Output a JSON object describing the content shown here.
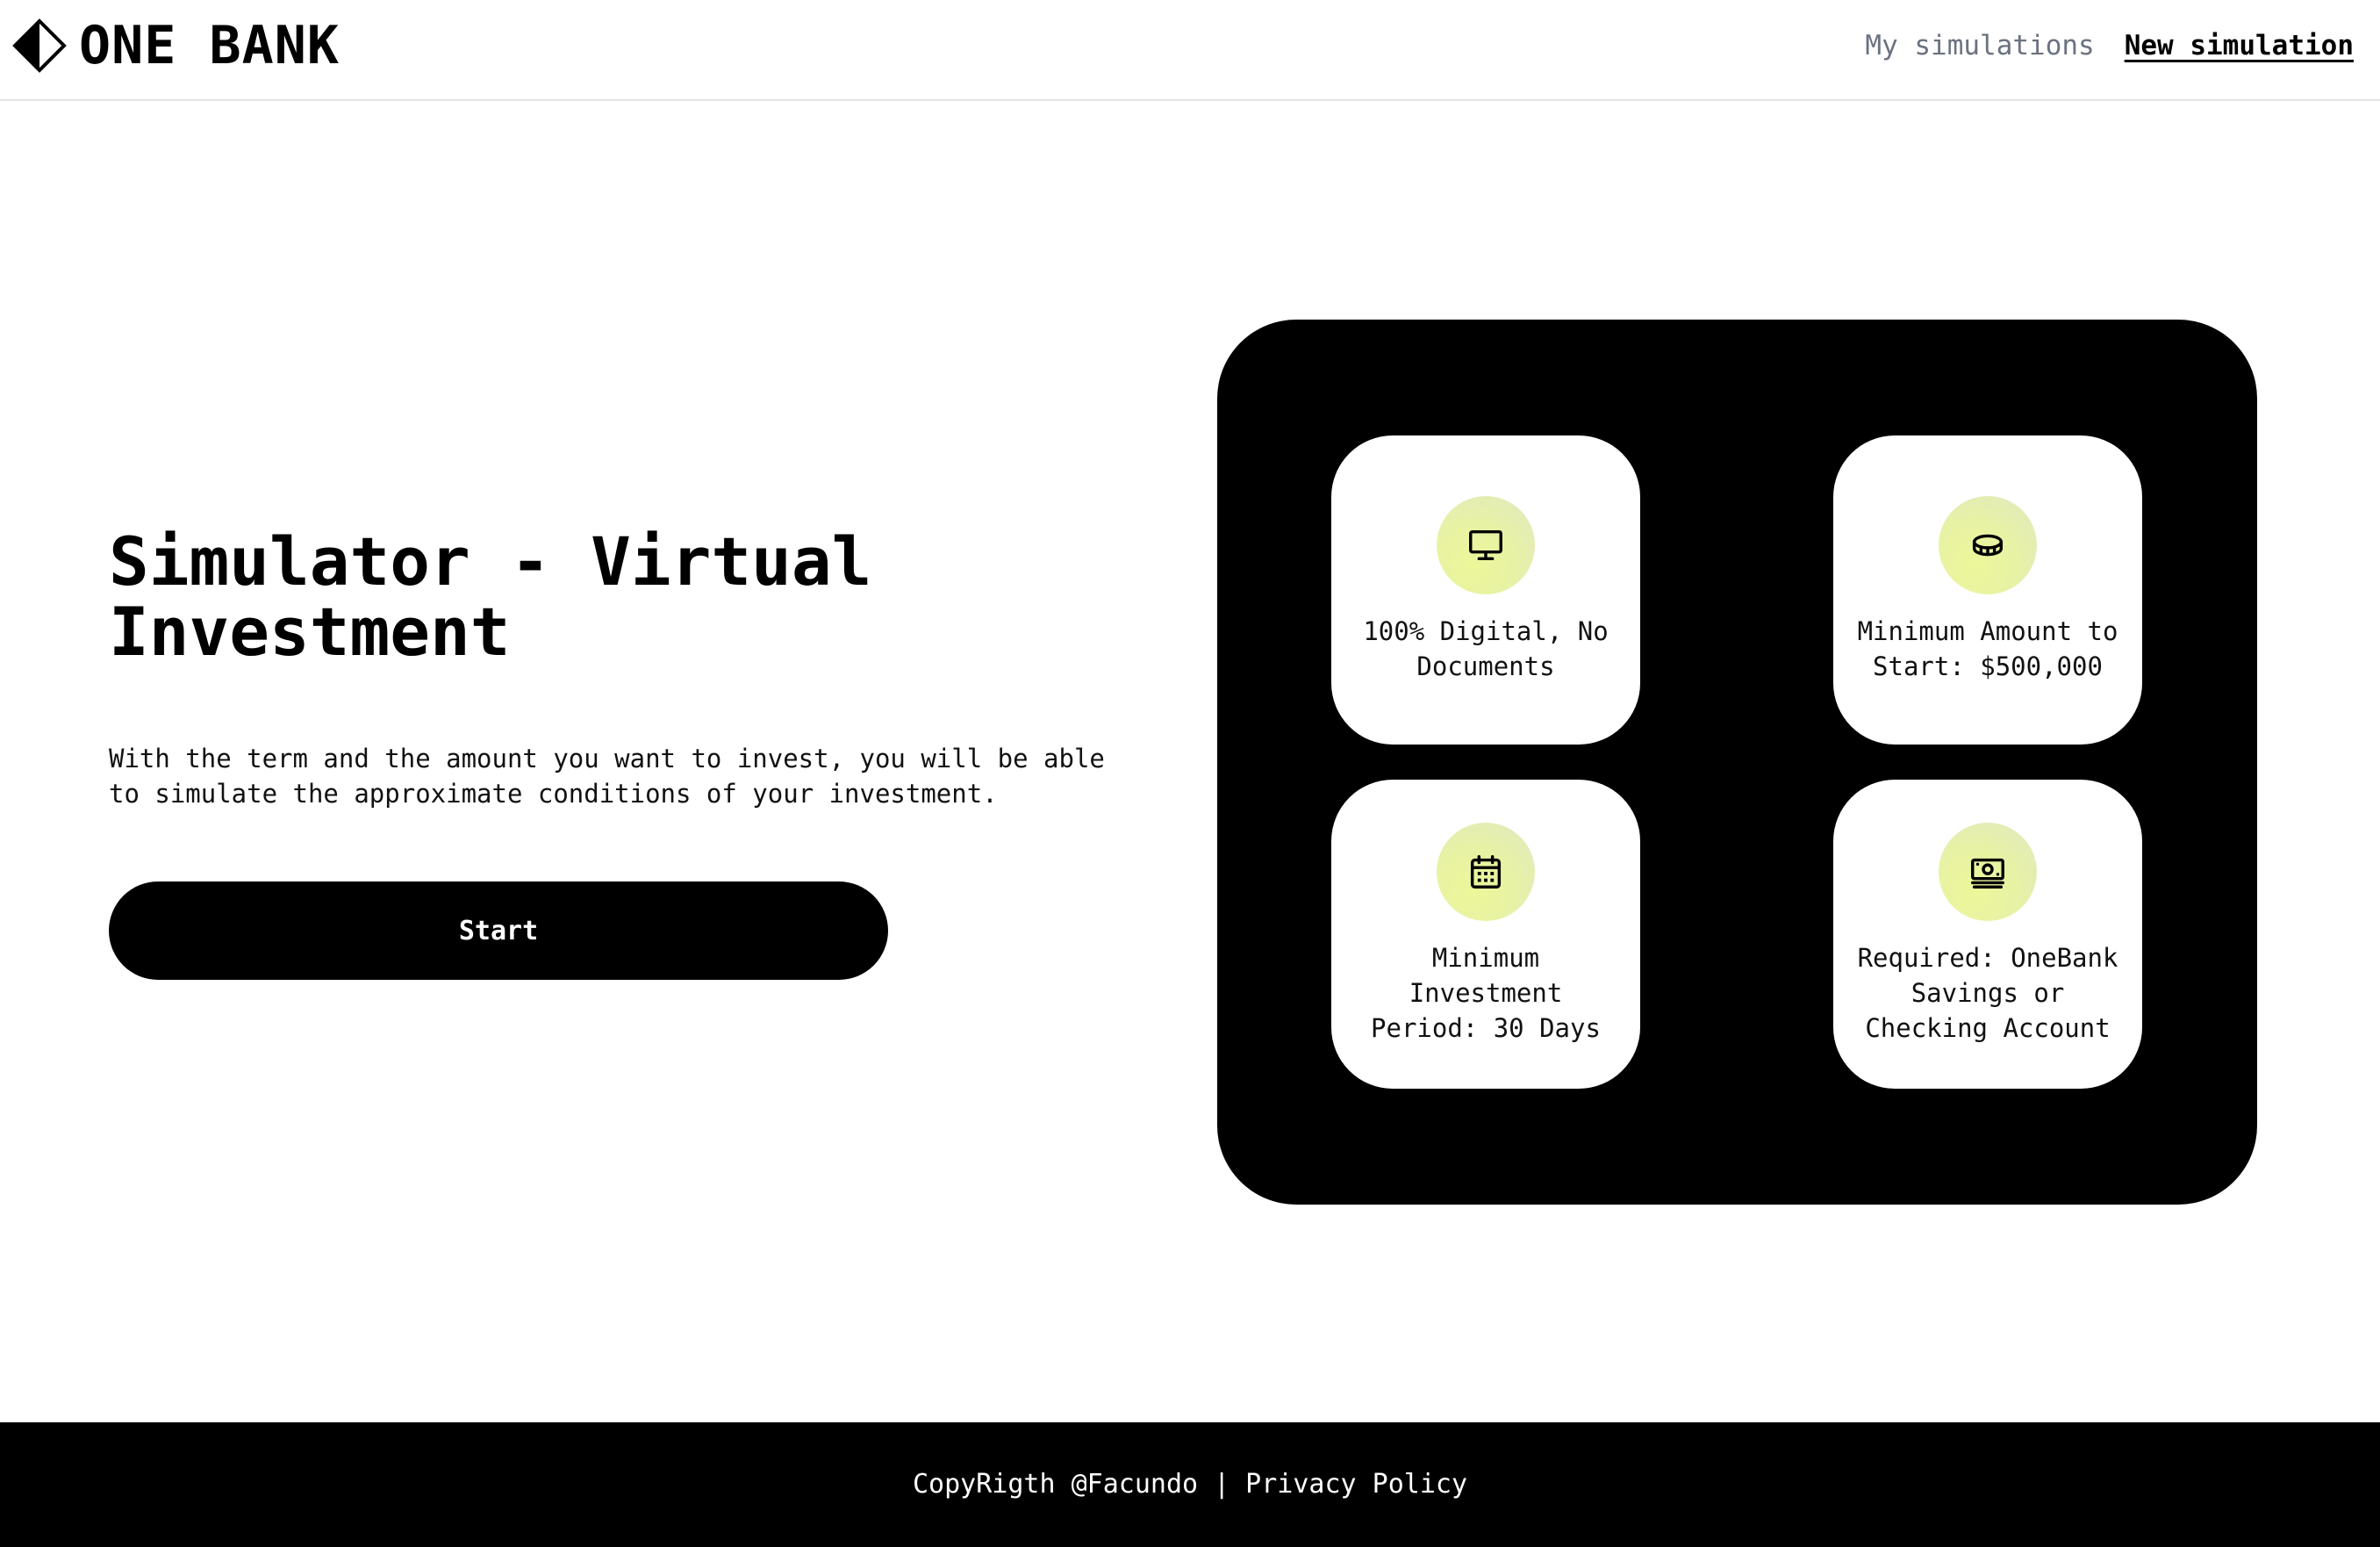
{
  "header": {
    "brand": "ONE BANK",
    "nav": {
      "my_simulations": "My simulations",
      "new_simulation": "New simulation"
    }
  },
  "hero": {
    "title": "Simulator - Virtual Investment",
    "description": "With the term and the amount you want to invest, you will be able to simulate the approximate conditions of your investment.",
    "start_label": "Start"
  },
  "features": [
    {
      "icon": "monitor-icon",
      "text": "100% Digital, No Documents"
    },
    {
      "icon": "coin-icon",
      "text": "Minimum Amount to Start: $500,000"
    },
    {
      "icon": "calendar-icon",
      "text": "Minimum Investment Period: 30 Days"
    },
    {
      "icon": "banknote-icon",
      "text": "Required: OneBank Savings or Checking Account"
    }
  ],
  "footer": {
    "copyright": "CopyRigth @Facundo",
    "separator": "|",
    "privacy": "Privacy Policy"
  },
  "colors": {
    "primary": "#000000",
    "background": "#ffffff",
    "icon_bg": "#e8f2a4",
    "nav_muted": "#6b7280"
  }
}
